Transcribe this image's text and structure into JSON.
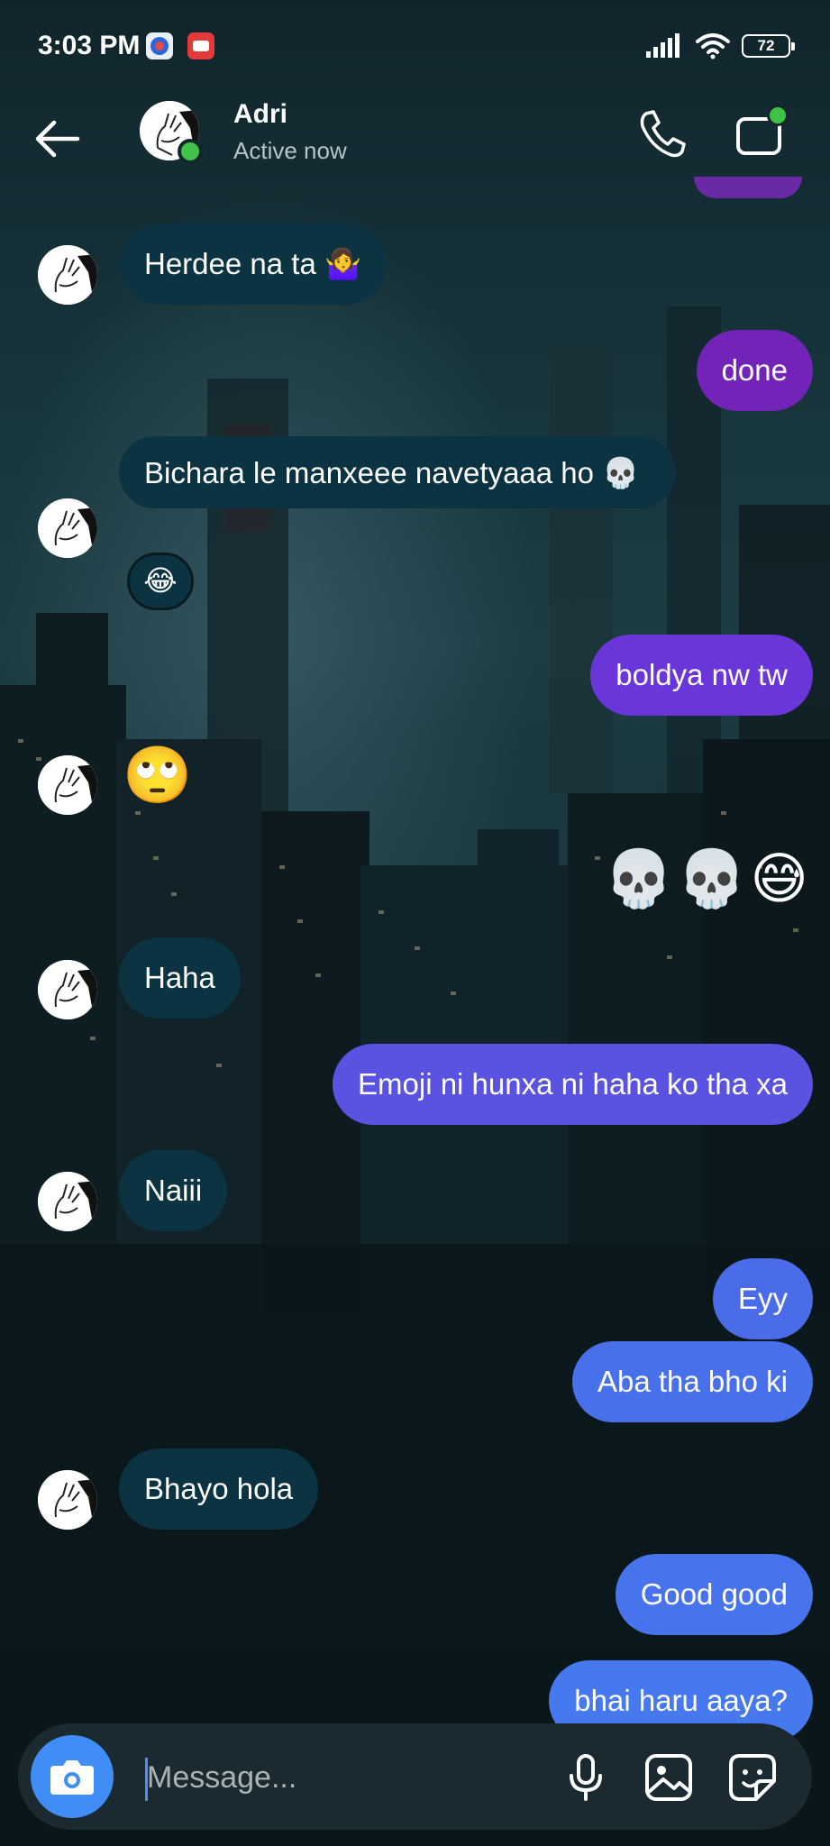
{
  "status_bar": {
    "time": "3:03 PM",
    "battery": "72"
  },
  "header": {
    "contact_name": "Adri",
    "contact_status": "Active now"
  },
  "messages": [
    {
      "from": "them",
      "text": "Herdee na ta 🤷‍♀️"
    },
    {
      "from": "me",
      "text": "done"
    },
    {
      "from": "them",
      "text": "Bichara le manxeee navetyaaa ho 💀",
      "reaction": "😂"
    },
    {
      "from": "me",
      "text": "boldya nw tw"
    },
    {
      "from": "them",
      "text": "🙄"
    },
    {
      "from": "me",
      "text": "💀💀😅"
    },
    {
      "from": "them",
      "text": "Haha"
    },
    {
      "from": "me",
      "text": "Emoji ni hunxa ni haha ko tha xa"
    },
    {
      "from": "them",
      "text": "Naiii"
    },
    {
      "from": "me",
      "text": "Eyy"
    },
    {
      "from": "me",
      "text": "Aba tha bho ki"
    },
    {
      "from": "them",
      "text": "Bhayo hola"
    },
    {
      "from": "me",
      "text": "Good good"
    },
    {
      "from": "me",
      "text": "bhai haru aaya?"
    }
  ],
  "composer": {
    "placeholder": "Message..."
  },
  "colors": {
    "incoming_bubble": "#0b3341",
    "outgoing_purple": "#7124b7",
    "outgoing_blue": "#4774ec",
    "online_green": "#3ec248",
    "camera_blue": "#3f8df5"
  }
}
